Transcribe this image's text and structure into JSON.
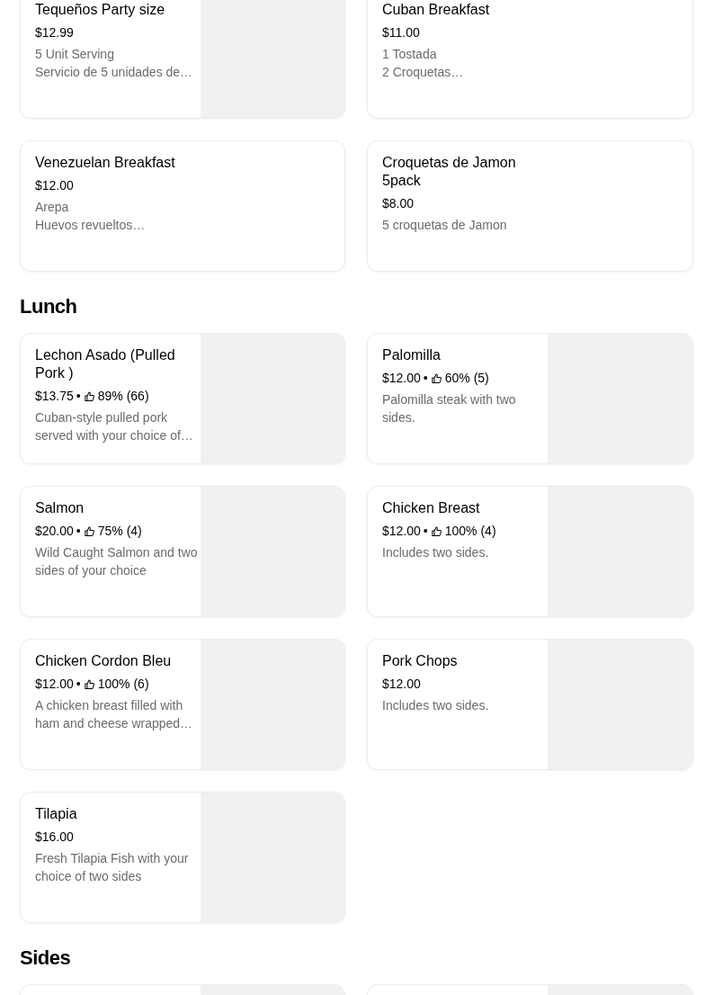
{
  "sections": [
    {
      "items": [
        {
          "title": "Tequeños Party size",
          "price": "$12.99",
          "description": "5 Unit Serving\nServicio de 5 unidades de…",
          "has_image": true
        },
        {
          "title": "Cuban Breakfast",
          "price": "$11.00",
          "description": "1 Tostada\n2 Croquetas…",
          "has_image": false
        },
        {
          "title": "Venezuelan Breakfast",
          "price": "$12.00",
          "description": "Arepa\nHuevos revueltos…",
          "has_image": false
        },
        {
          "title": "Croquetas de Jamon 5pack",
          "price": "$8.00",
          "description": "5 croquetas de Jamon",
          "has_image": false
        }
      ]
    },
    {
      "title": "Lunch",
      "items": [
        {
          "title": "Lechon Asado (Pulled Pork )",
          "price": "$13.75",
          "separator": "•",
          "rating": "89% (66)",
          "description": "Cuban-style pulled pork served with your choice of…",
          "has_image": true
        },
        {
          "title": "Palomilla",
          "price": "$12.00",
          "separator": "•",
          "rating": "60% (5)",
          "description": "Palomilla steak with two sides.",
          "has_image": true
        },
        {
          "title": "Salmon",
          "price": "$20.00",
          "separator": "•",
          "rating": "75% (4)",
          "description": "Wild Caught Salmon and two sides of your choice",
          "has_image": true
        },
        {
          "title": "Chicken Breast",
          "price": "$12.00",
          "separator": "•",
          "rating": "100% (4)",
          "description": "Includes two sides.",
          "has_image": true
        },
        {
          "title": "Chicken Cordon Bleu",
          "price": "$12.00",
          "separator": "•",
          "rating": "100% (6)",
          "description": "A chicken breast filled with ham and cheese wrapped…",
          "has_image": true
        },
        {
          "title": "Pork Chops",
          "price": "$12.00",
          "description": "Includes two sides.",
          "has_image": true
        },
        {
          "title": "Tilapia",
          "price": "$16.00",
          "description": "Fresh Tilapia Fish with your choice of two sides",
          "has_image": true
        }
      ]
    },
    {
      "title": "Sides",
      "items": [
        {
          "has_image": true
        },
        {
          "has_image": true
        }
      ]
    }
  ]
}
